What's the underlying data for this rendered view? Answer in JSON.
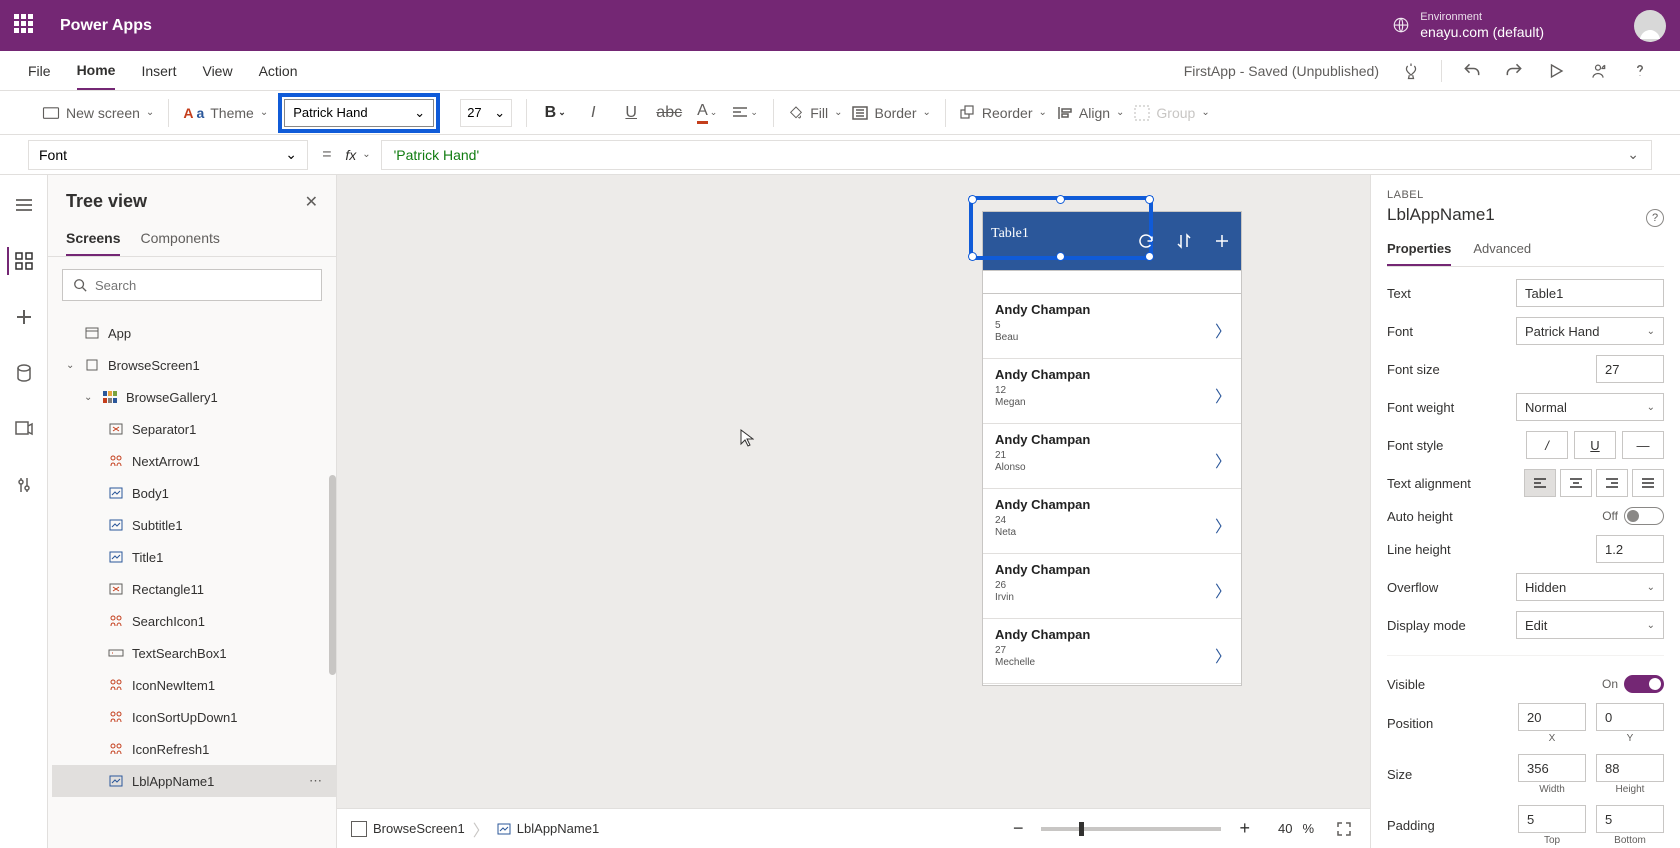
{
  "header": {
    "brand": "Power Apps",
    "env_label": "Environment",
    "env_name": "enayu.com (default)"
  },
  "menu": {
    "items": [
      "File",
      "Home",
      "Insert",
      "View",
      "Action"
    ],
    "active": "Home",
    "app_status": "FirstApp - Saved (Unpublished)"
  },
  "ribbon": {
    "new_screen": "New screen",
    "theme": "Theme",
    "font_name": "Patrick Hand",
    "font_size": "27",
    "fill": "Fill",
    "border": "Border",
    "reorder": "Reorder",
    "align": "Align",
    "group": "Group"
  },
  "formula": {
    "property": "Font",
    "fx": "fx",
    "value": "'Patrick Hand'"
  },
  "tree": {
    "title": "Tree view",
    "tabs": [
      "Screens",
      "Components"
    ],
    "search_placeholder": "Search",
    "nodes": {
      "app": "App",
      "browse_screen": "BrowseScreen1",
      "gallery": "BrowseGallery1",
      "separator": "Separator1",
      "next": "NextArrow1",
      "body": "Body1",
      "subtitle": "Subtitle1",
      "title_node": "Title1",
      "rectangle": "Rectangle11",
      "search_icon": "SearchIcon1",
      "text_search": "TextSearchBox1",
      "new_item": "IconNewItem1",
      "sort": "IconSortUpDown1",
      "refresh": "IconRefresh1",
      "app_name": "LblAppName1"
    }
  },
  "canvas": {
    "title_text": "Table1",
    "rows": [
      {
        "name": "Andy Champan",
        "num": "5",
        "sub": "Beau"
      },
      {
        "name": "Andy Champan",
        "num": "12",
        "sub": "Megan"
      },
      {
        "name": "Andy Champan",
        "num": "21",
        "sub": "Alonso"
      },
      {
        "name": "Andy Champan",
        "num": "24",
        "sub": "Neta"
      },
      {
        "name": "Andy Champan",
        "num": "26",
        "sub": "Irvin"
      },
      {
        "name": "Andy Champan",
        "num": "27",
        "sub": "Mechelle"
      }
    ],
    "breadcrumb1": "BrowseScreen1",
    "breadcrumb2": "LblAppName1",
    "zoom": "40",
    "zoom_unit": "%"
  },
  "props": {
    "type_label": "LABEL",
    "control_name": "LblAppName1",
    "tabs": [
      "Properties",
      "Advanced"
    ],
    "text_label": "Text",
    "text_value": "Table1",
    "font_label": "Font",
    "font_value": "Patrick Hand",
    "fontsize_label": "Font size",
    "fontsize_value": "27",
    "fontweight_label": "Font weight",
    "fontweight_value": "Normal",
    "fontstyle_label": "Font style",
    "textalign_label": "Text alignment",
    "autoheight_label": "Auto height",
    "autoheight_off": "Off",
    "lineheight_label": "Line height",
    "lineheight_value": "1.2",
    "overflow_label": "Overflow",
    "overflow_value": "Hidden",
    "displaymode_label": "Display mode",
    "displaymode_value": "Edit",
    "visible_label": "Visible",
    "visible_on": "On",
    "position_label": "Position",
    "pos_x": "20",
    "pos_y": "0",
    "x_label": "X",
    "y_label": "Y",
    "size_label": "Size",
    "size_w": "356",
    "size_h": "88",
    "w_label": "Width",
    "h_label": "Height",
    "padding_label": "Padding",
    "pad_t": "5",
    "pad_b": "5",
    "t_label": "Top",
    "b_label": "Bottom"
  }
}
